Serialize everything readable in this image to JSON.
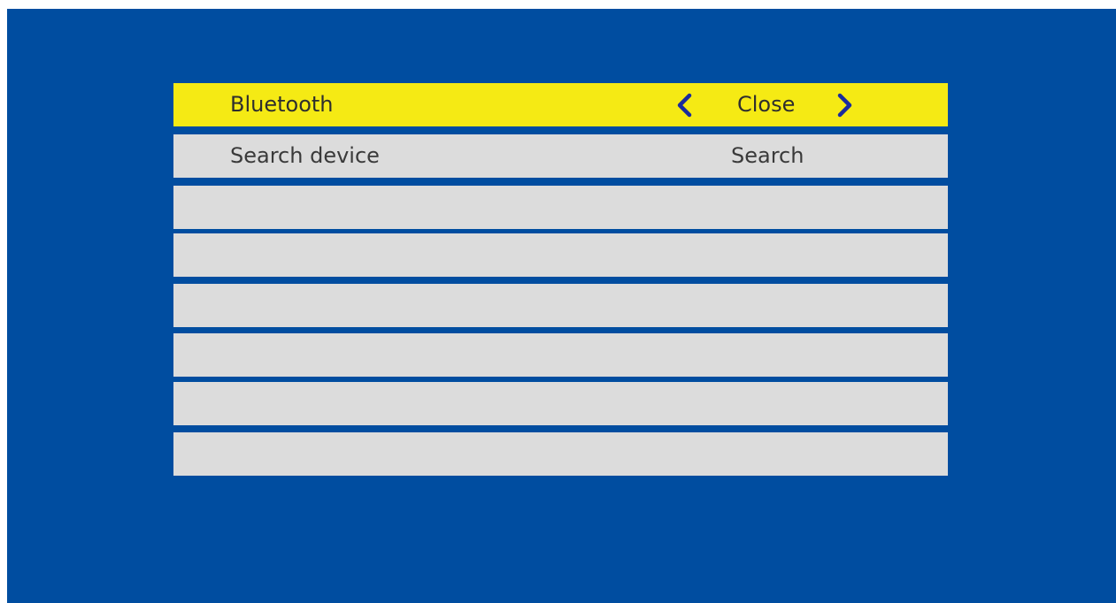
{
  "menu": {
    "rows": [
      {
        "label": "Bluetooth",
        "value": "Close",
        "selected": true
      },
      {
        "label": "Search device",
        "value": "Search"
      },
      {
        "label": "",
        "value": ""
      },
      {
        "label": "",
        "value": ""
      },
      {
        "label": "",
        "value": ""
      },
      {
        "label": "",
        "value": ""
      },
      {
        "label": "",
        "value": ""
      },
      {
        "label": "",
        "value": ""
      }
    ]
  },
  "icons": {
    "prev": "chevron-left-icon",
    "next": "chevron-right-icon"
  },
  "colors": {
    "background": "#004da0",
    "row": "#dcdcdc",
    "selected_row": "#f5ea14",
    "arrow": "#1a2b9c"
  }
}
